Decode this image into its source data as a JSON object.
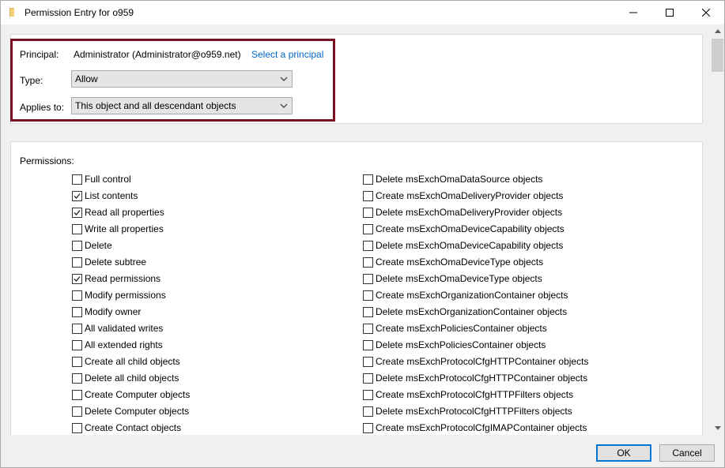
{
  "window": {
    "title": "Permission Entry for o959"
  },
  "header": {
    "principal_label": "Principal:",
    "principal_value": "Administrator (Administrator@o959.net)",
    "select_principal_link": "Select a principal",
    "type_label": "Type:",
    "type_value": "Allow",
    "applies_label": "Applies to:",
    "applies_value": "This object and all descendant objects"
  },
  "permissions": {
    "title": "Permissions:",
    "left": [
      {
        "label": "Full control",
        "checked": false
      },
      {
        "label": "List contents",
        "checked": true
      },
      {
        "label": "Read all properties",
        "checked": true
      },
      {
        "label": "Write all properties",
        "checked": false
      },
      {
        "label": "Delete",
        "checked": false
      },
      {
        "label": "Delete subtree",
        "checked": false
      },
      {
        "label": "Read permissions",
        "checked": true
      },
      {
        "label": "Modify permissions",
        "checked": false
      },
      {
        "label": "Modify owner",
        "checked": false
      },
      {
        "label": "All validated writes",
        "checked": false
      },
      {
        "label": "All extended rights",
        "checked": false
      },
      {
        "label": "Create all child objects",
        "checked": false
      },
      {
        "label": "Delete all child objects",
        "checked": false
      },
      {
        "label": "Create Computer objects",
        "checked": false
      },
      {
        "label": "Delete Computer objects",
        "checked": false
      },
      {
        "label": "Create Contact objects",
        "checked": false
      }
    ],
    "right": [
      {
        "label": "Delete msExchOmaDataSource objects",
        "checked": false
      },
      {
        "label": "Create msExchOmaDeliveryProvider objects",
        "checked": false
      },
      {
        "label": "Delete msExchOmaDeliveryProvider objects",
        "checked": false
      },
      {
        "label": "Create msExchOmaDeviceCapability objects",
        "checked": false
      },
      {
        "label": "Delete msExchOmaDeviceCapability objects",
        "checked": false
      },
      {
        "label": "Create msExchOmaDeviceType objects",
        "checked": false
      },
      {
        "label": "Delete msExchOmaDeviceType objects",
        "checked": false
      },
      {
        "label": "Create msExchOrganizationContainer objects",
        "checked": false
      },
      {
        "label": "Delete msExchOrganizationContainer objects",
        "checked": false
      },
      {
        "label": "Create msExchPoliciesContainer objects",
        "checked": false
      },
      {
        "label": "Delete msExchPoliciesContainer objects",
        "checked": false
      },
      {
        "label": "Create msExchProtocolCfgHTTPContainer objects",
        "checked": false
      },
      {
        "label": "Delete msExchProtocolCfgHTTPContainer objects",
        "checked": false
      },
      {
        "label": "Create msExchProtocolCfgHTTPFilters objects",
        "checked": false
      },
      {
        "label": "Delete msExchProtocolCfgHTTPFilters objects",
        "checked": false
      },
      {
        "label": "Create msExchProtocolCfgIMAPContainer objects",
        "checked": false
      }
    ]
  },
  "footer": {
    "ok_label": "OK",
    "cancel_label": "Cancel"
  },
  "colors": {
    "highlight": "#7a1022",
    "link": "#0066cc",
    "ok_border": "#0078d7"
  },
  "icons": {
    "title": "folder-icon",
    "minimize": "minimize-icon",
    "maximize": "maximize-icon",
    "close": "close-icon"
  }
}
